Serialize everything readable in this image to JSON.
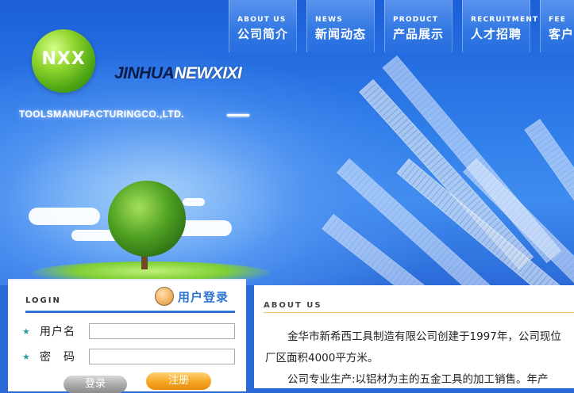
{
  "brand": {
    "logo_text": "NXX",
    "name_part1": "JINHUA",
    "name_part2": "NEWXIXI",
    "tagline": "TOOLSMANUFACTURINGCO.,LTD."
  },
  "nav": {
    "items": [
      {
        "en": "ABOUT US",
        "cn": "公司简介"
      },
      {
        "en": "NEWS",
        "cn": "新闻动态"
      },
      {
        "en": "PRODUCT",
        "cn": "产品展示"
      },
      {
        "en": "RECRUITMENT",
        "cn": "人才招聘"
      },
      {
        "en": "FEE",
        "cn": "客户"
      }
    ]
  },
  "login": {
    "title_en": "LOGIN",
    "title_cn": "用户登录",
    "username_label": "用户名",
    "password_label": "密　码",
    "username_value": "",
    "password_value": "",
    "login_button": "登录",
    "register_button": "注册"
  },
  "about": {
    "title_en": "ABOUT US",
    "line1": "金华市新希西工具制造有限公司创建于1997年，公司现位",
    "line2": "厂区面积4000平方米。",
    "line3": "公司专业生产:以铝材为主的五金工具的加工销售。年产"
  },
  "colors": {
    "accent_blue": "#2f73d0",
    "banner_blue": "#2a6ad8",
    "register_orange": "#f5a623",
    "logo_green": "#8fd42c"
  }
}
